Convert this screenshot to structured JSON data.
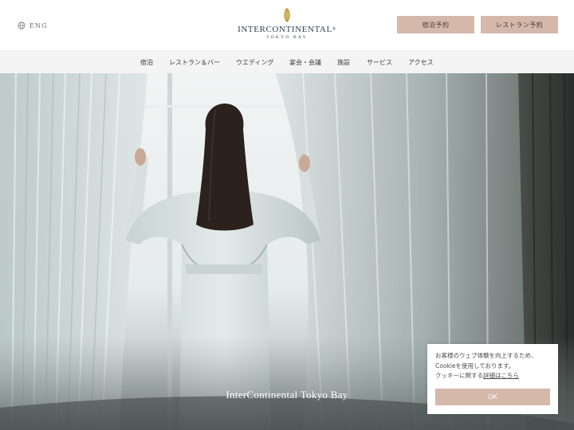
{
  "header": {
    "language_label": "ENG",
    "language_icon": "globe-icon",
    "logo": {
      "name": "INTERCONTINENTAL",
      "trademark": "®",
      "location": "TOKYO BAY",
      "emblem_color": "#c9a24a"
    },
    "buttons": {
      "stay_reservation": "宿泊予約",
      "restaurant_reservation": "レストラン予約"
    }
  },
  "nav": {
    "items": [
      {
        "label": "宿泊"
      },
      {
        "label": "レストラン＆バー"
      },
      {
        "label": "ウエディング"
      },
      {
        "label": "宴会・会議"
      },
      {
        "label": "施設"
      },
      {
        "label": "サービス"
      },
      {
        "label": "アクセス"
      }
    ]
  },
  "hero": {
    "caption": "InterContinental Tokyo Bay"
  },
  "cookie": {
    "line1": "お客様のウェブ体験を向上するため、",
    "line2": "Cookieを使用しております。",
    "line3_prefix": "クッキーに関する",
    "link_text": "詳細はこちら",
    "ok_label": "OK"
  },
  "colors": {
    "accent_button": "#d4b8aa",
    "nav_background": "#f4f4f4",
    "logo_text": "#2f3e4e"
  }
}
